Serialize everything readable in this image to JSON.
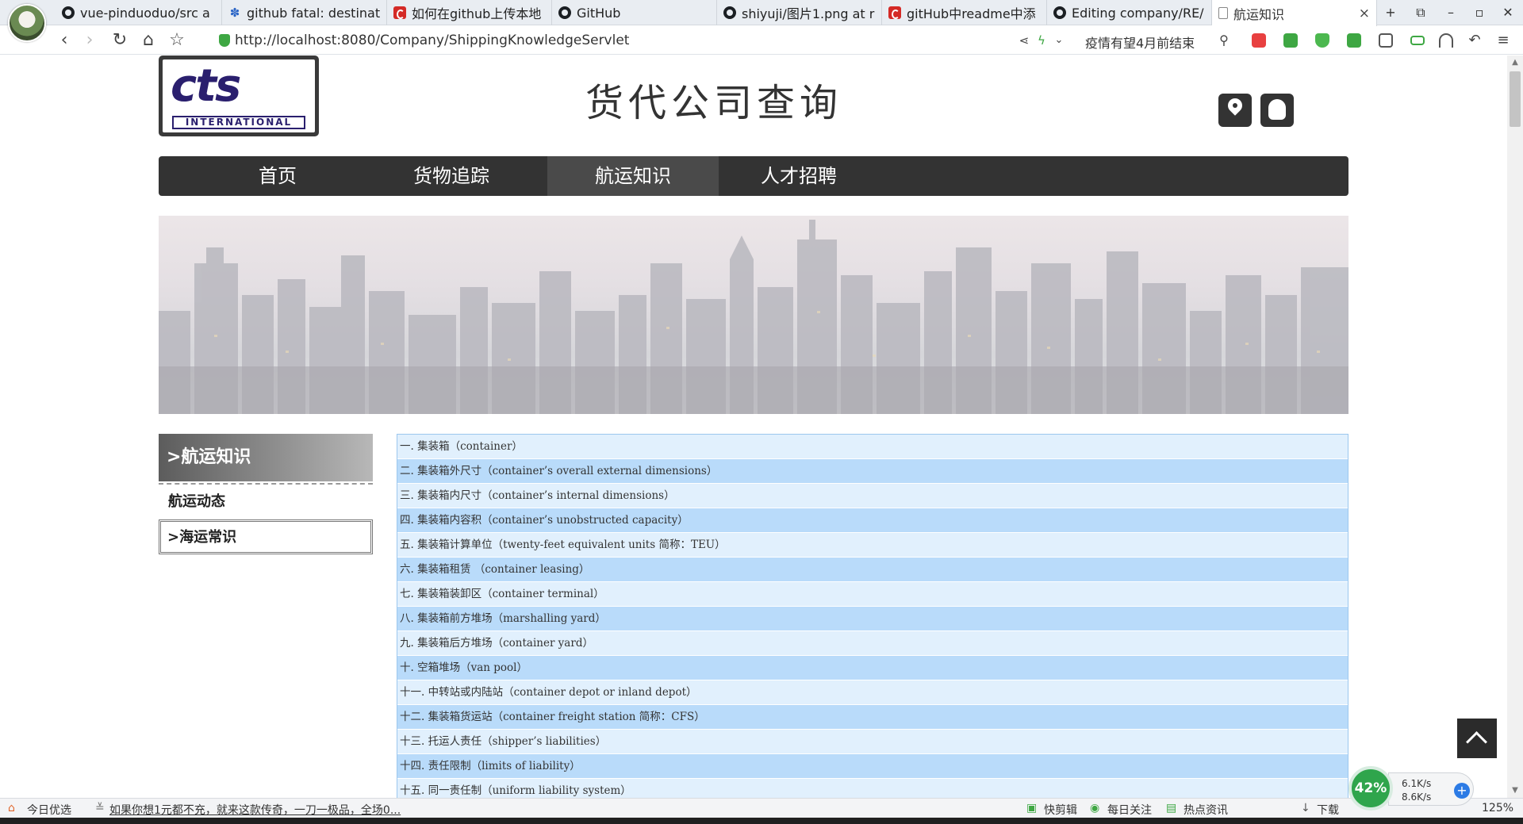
{
  "browser": {
    "tabs": [
      {
        "title": "vue-pinduoduo/src a",
        "icon": "github-icon"
      },
      {
        "title": "github fatal: destinat",
        "icon": "baidu-icon"
      },
      {
        "title": "如何在github上传本地",
        "icon": "csdn-icon"
      },
      {
        "title": "GitHub",
        "icon": "github-icon"
      },
      {
        "title": "shiyuji/图片1.png at r",
        "icon": "github-icon"
      },
      {
        "title": "gitHub中readme中添",
        "icon": "csdn-icon"
      },
      {
        "title": "Editing company/RE/",
        "icon": "github-icon"
      },
      {
        "title": "航运知识",
        "icon": "page-icon"
      }
    ],
    "new_tab": "+",
    "url": "http://localhost:8080/Company/ShippingKnowledgeServlet",
    "search_hint": "疫情有望4月前结束"
  },
  "site": {
    "logo_mark": "cts",
    "logo_text": "INTERNATIONAL",
    "title": "货代公司查询"
  },
  "nav": [
    "首页",
    "货物追踪",
    "航运知识",
    "人才招聘"
  ],
  "sidebar": {
    "title": ">航运知识",
    "items": [
      "航运动态",
      ">海运常识"
    ]
  },
  "knowledge_list": [
    "一. 集装箱（container）",
    "二. 集装箱外尺寸（container’s overall external dimensions）",
    "三. 集装箱内尺寸（container’s internal dimensions）",
    "四. 集装箱内容积（container’s unobstructed capacity）",
    "五. 集装箱计算单位（twenty-feet equivalent units 简称：TEU）",
    "六. 集装箱租赁 （container leasing）",
    "七. 集装箱装卸区（container terminal）",
    "八. 集装箱前方堆场（marshalling yard）",
    "九. 集装箱后方堆场（container yard）",
    "十. 空箱堆场（van pool）",
    "十一. 中转站或内陆站（container depot or inland depot）",
    "十二. 集装箱货运站（container freight station 简称：CFS）",
    "十三. 托运人责任（shipper’s liabilities）",
    "十四. 责任限制（limits of liability）",
    "十五. 同一责任制（uniform liability system）"
  ],
  "statusbar": {
    "left_label": "今日优选",
    "ad_text": "如果你想1元都不充，就来这款传奇，一刀一极品，全场0...",
    "items": [
      "快剪辑",
      "每日关注",
      "热点资讯",
      "下载"
    ],
    "zoom": "125%"
  },
  "net_widget": {
    "percent": "42%",
    "up": "6.1K/s",
    "down": "8.6K/s"
  },
  "colors": {
    "nav_bg": "#333333",
    "row_light": "#e1f0fd",
    "row_dark": "#b9dbfa",
    "logo_blue": "#2a1f6e"
  }
}
